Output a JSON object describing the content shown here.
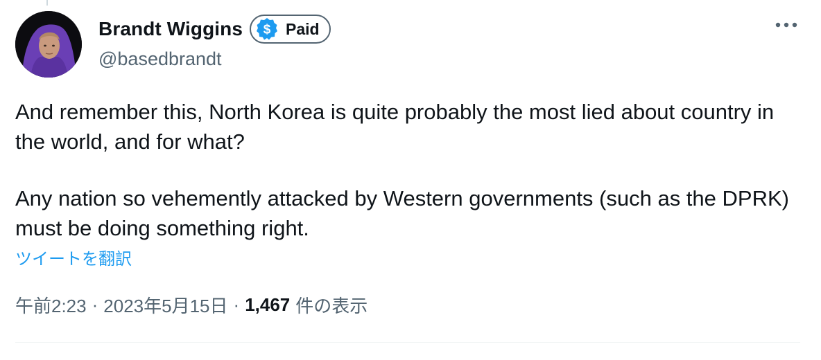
{
  "author": {
    "display_name": "Brandt Wiggins",
    "handle": "@basedbrandt",
    "badge_label": "Paid",
    "badge_icon": "dollar-sign-icon",
    "avatar_description": "person-in-purple-hoodie-avatar"
  },
  "menu": {
    "icon": "more-horizontal-icon",
    "glyph": "•••"
  },
  "tweet": {
    "paragraphs": [
      "And remember this, North Korea is quite probably the most lied about country in the world, and for what?",
      "Any nation so vehemently attacked by Western governments (such as the DPRK) must be doing something right."
    ],
    "translate_label": "ツイートを翻訳"
  },
  "meta": {
    "time": "午前2:23",
    "separator": "·",
    "date": "2023年5月15日",
    "views_count": "1,467",
    "views_label": "件の表示"
  },
  "colors": {
    "text_primary": "#0f1419",
    "text_secondary": "#536471",
    "link_blue": "#1d9bf0",
    "badge_blue": "#1d9bf0",
    "divider": "#eff3f4",
    "avatar_hoodie": "#6a3fb5"
  }
}
